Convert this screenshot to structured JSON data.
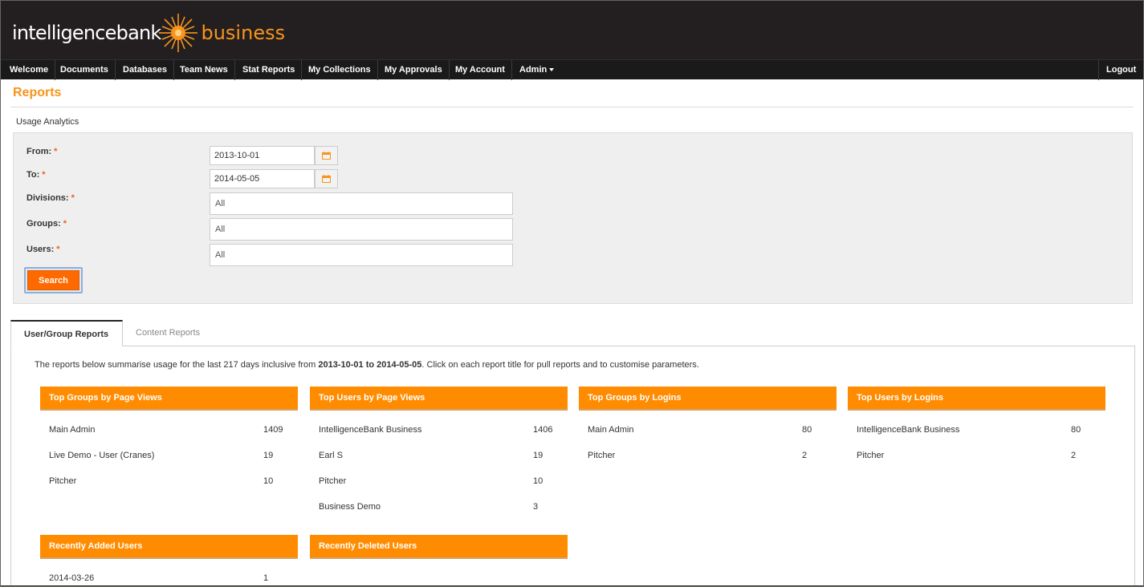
{
  "brand": {
    "name_part1": "intelligencebank",
    "name_part2": "business",
    "accent": "#f7941d",
    "logo_icon": "sun-burst-icon"
  },
  "nav": {
    "items": [
      "Welcome",
      "Documents",
      "Databases",
      "Team News",
      "Stat Reports",
      "My Collections",
      "My Approvals",
      "My Account",
      "Admin"
    ],
    "logout": "Logout"
  },
  "page": {
    "title": "Reports",
    "section": "Usage Analytics"
  },
  "filters": {
    "from_label": "From:",
    "to_label": "To:",
    "divisions_label": "Divisions:",
    "groups_label": "Groups:",
    "users_label": "Users:",
    "required_mark": "*",
    "from_value": "2013-10-01",
    "to_value": "2014-05-05",
    "divisions_value": "All",
    "groups_value": "All",
    "users_value": "All",
    "search_label": "Search",
    "search_color": "#ff6a00"
  },
  "tabs": [
    "User/Group Reports",
    "Content Reports"
  ],
  "summary": {
    "prefix": "The reports below summarise usage for the last 217 days inclusive from ",
    "range": "2013-10-01 to 2014-05-05",
    "suffix": ". Click on each report title for pull reports and to customise parameters."
  },
  "reports": {
    "top_groups_views": {
      "title": "Top Groups by Page Views",
      "rows": [
        {
          "name": "Main Admin",
          "value": "1409"
        },
        {
          "name": "Live Demo - User (Cranes)",
          "value": "19"
        },
        {
          "name": "Pitcher",
          "value": "10"
        }
      ]
    },
    "top_users_views": {
      "title": "Top Users by Page Views",
      "rows": [
        {
          "name": "IntelligenceBank Business",
          "value": "1406"
        },
        {
          "name": "Earl S",
          "value": "19"
        },
        {
          "name": "Pitcher",
          "value": "10"
        },
        {
          "name": "Business Demo",
          "value": "3"
        }
      ]
    },
    "top_groups_logins": {
      "title": "Top Groups by Logins",
      "rows": [
        {
          "name": "Main Admin",
          "value": "80"
        },
        {
          "name": "Pitcher",
          "value": "2"
        }
      ]
    },
    "top_users_logins": {
      "title": "Top Users by Logins",
      "rows": [
        {
          "name": "IntelligenceBank Business",
          "value": "80"
        },
        {
          "name": "Pitcher",
          "value": "2"
        }
      ]
    },
    "recently_added": {
      "title": "Recently Added Users",
      "rows": [
        {
          "name": "2014-03-26",
          "value": "1"
        }
      ]
    },
    "recently_deleted": {
      "title": "Recently Deleted Users",
      "rows": []
    }
  }
}
